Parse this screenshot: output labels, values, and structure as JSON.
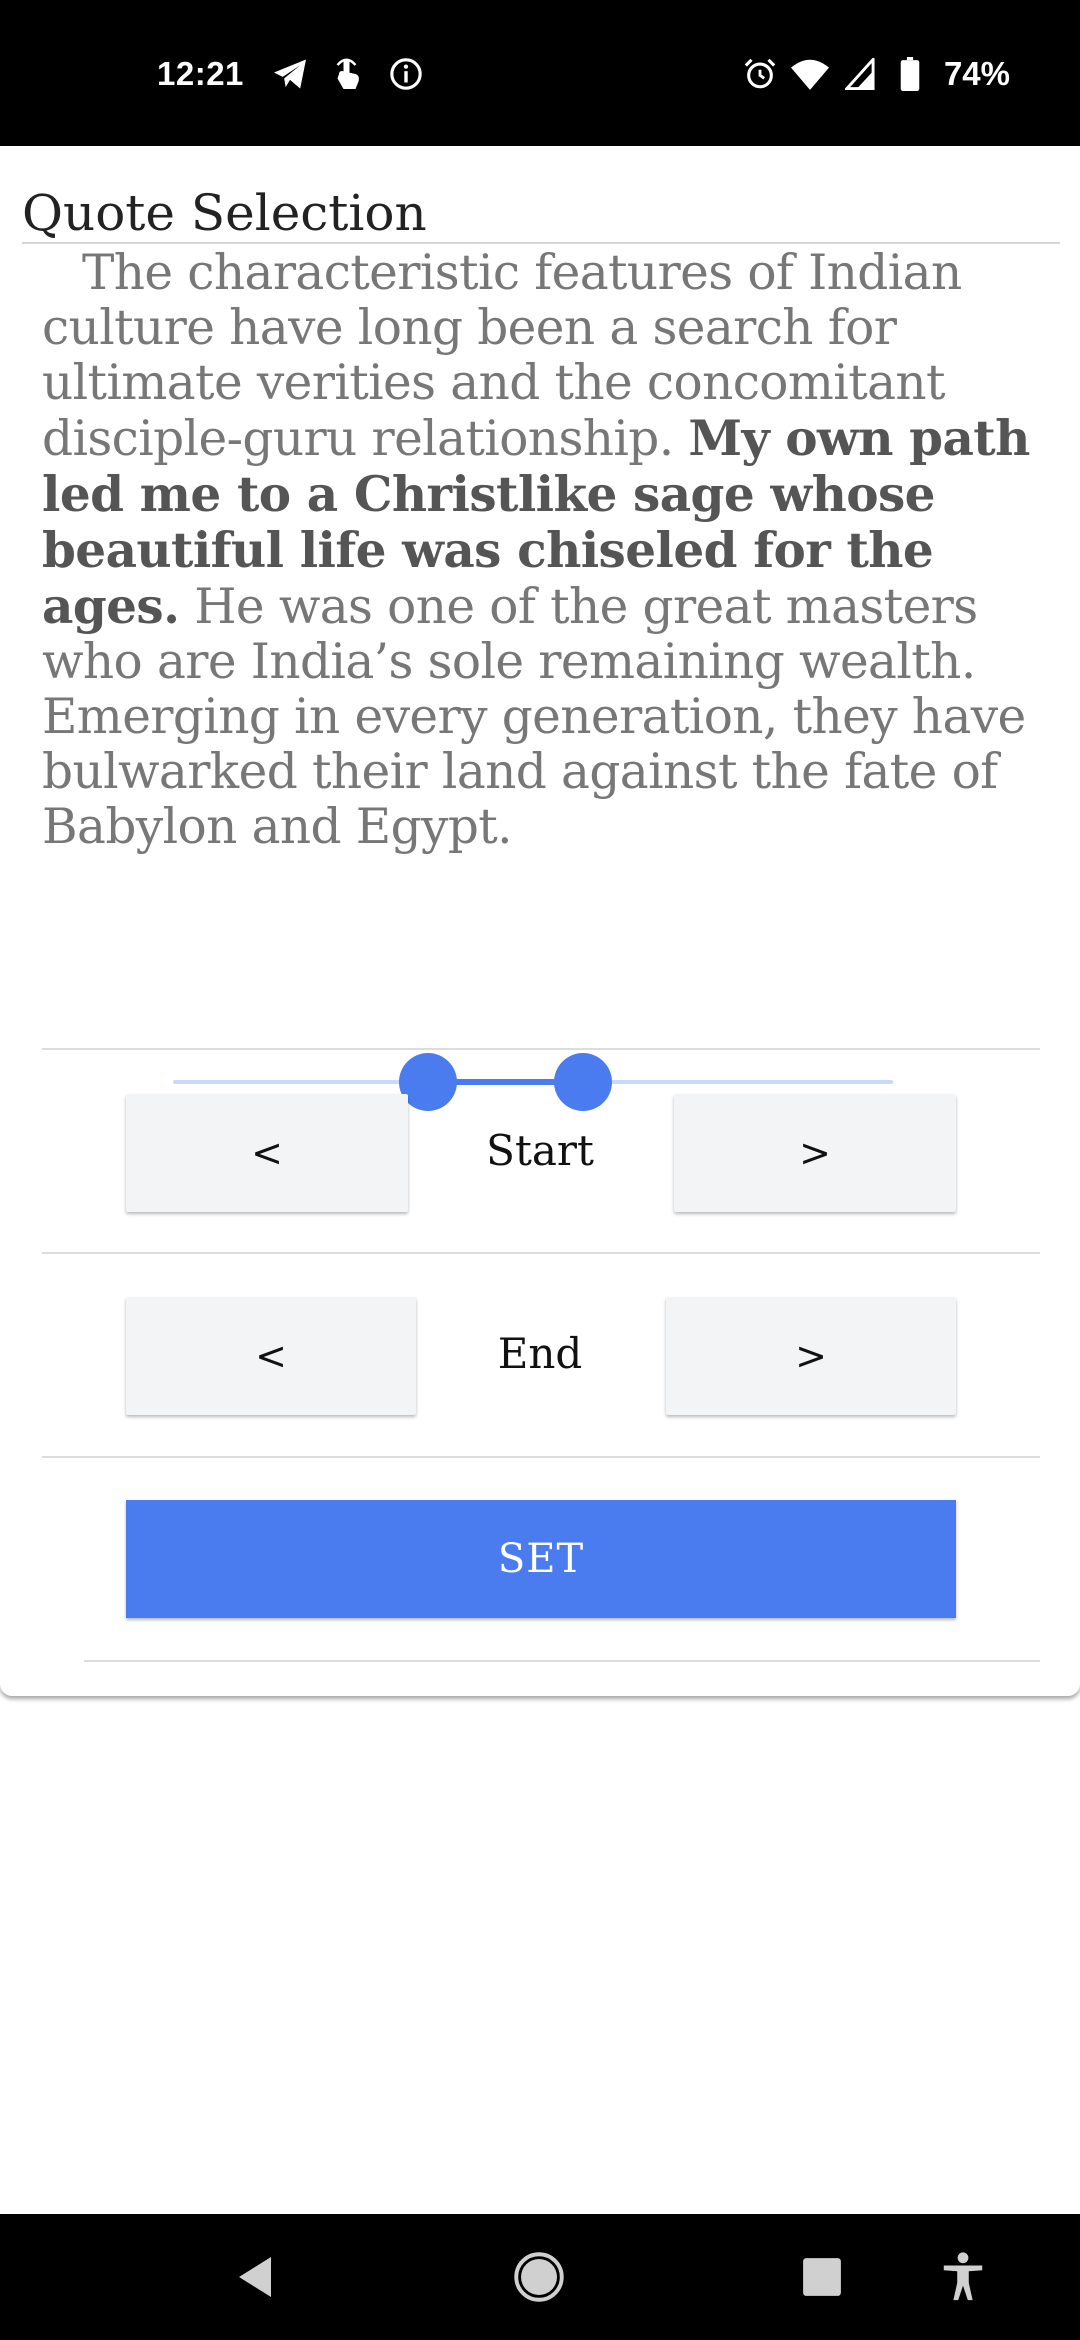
{
  "status_bar": {
    "time": "12:21",
    "battery": "74%",
    "left_icons": [
      "telegram-icon",
      "touch-icon",
      "info-icon"
    ],
    "right_icons": [
      "alarm-icon",
      "wifi-icon",
      "signal-icon",
      "battery-icon"
    ]
  },
  "dialog": {
    "title": "Quote Selection",
    "quote": {
      "before": "The characteristic features of Indian culture have long been a search for ultimate verities and the concomitant disciple-guru  relationship. ",
      "selected": "My own path led me to a Christlike sage whose beautiful life was chiseled for the ages.",
      "after": " He was one of the great masters who are India’s sole remaining wealth. Emerging in every generation, they have bulwarked their land against the fate of Babylon and Egypt."
    },
    "slider": {
      "start_fraction": 0.39,
      "end_fraction": 0.61
    },
    "start_row": {
      "prev": "<",
      "label": "Start",
      "next": ">"
    },
    "end_row": {
      "prev": "<",
      "label": "End",
      "next": ">"
    },
    "set_label": "SET"
  },
  "colors": {
    "accent": "#4a7cf0",
    "track": "#c9d8fb",
    "button_bg": "#f3f4f6"
  },
  "nav_bar": {
    "icons": [
      "back-icon",
      "home-icon",
      "recents-icon",
      "accessibility-icon"
    ]
  }
}
